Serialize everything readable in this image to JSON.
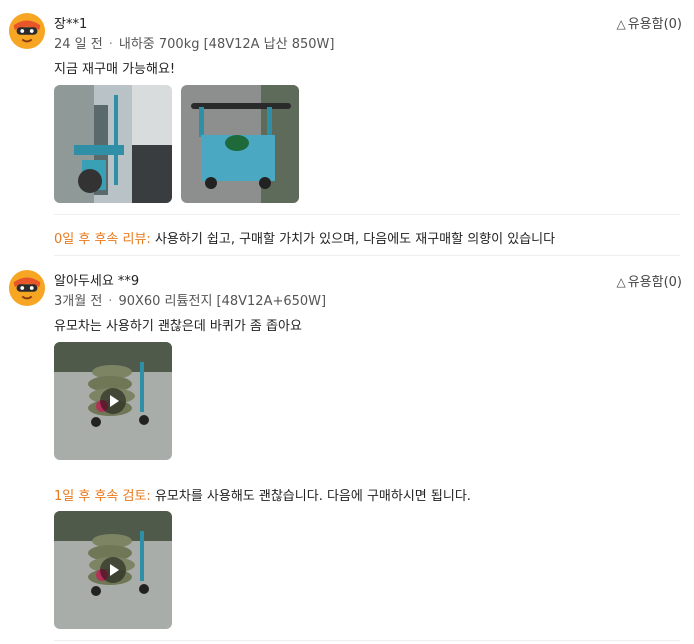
{
  "reviews": [
    {
      "user": "장**1",
      "date": "24 일 전",
      "option": "내하중 700kg [48V12A 납산 850W]",
      "helpful": "유용함(0)",
      "text": "지금 재구매 가능해요!",
      "followup_tag": "0일 후 후속 리뷰:",
      "followup_text": " 사용하기 쉽고, 구매할 가치가 있으며, 다음에도 재구매할 의향이 있습니다"
    },
    {
      "user": "알아두세요 **9",
      "date": "3개월 전",
      "option": "90X60 리튬전지 [48V12A+650W]",
      "helpful": "유용함(0)",
      "text": "유모차는 사용하기 괜찮은데 바퀴가 좀 좁아요",
      "followup_tag": "1일 후 후속 검토:",
      "followup_text": " 유모차를 사용해도 괜찮습니다. 다음에 구매하시면 됩니다."
    }
  ],
  "colors": {
    "accent": "#e87a1f",
    "divider": "#eeeeee"
  },
  "icons": {
    "helpful": "triangle-up-outline-icon",
    "play": "play-icon",
    "avatar": "masked-mascot-avatar"
  }
}
